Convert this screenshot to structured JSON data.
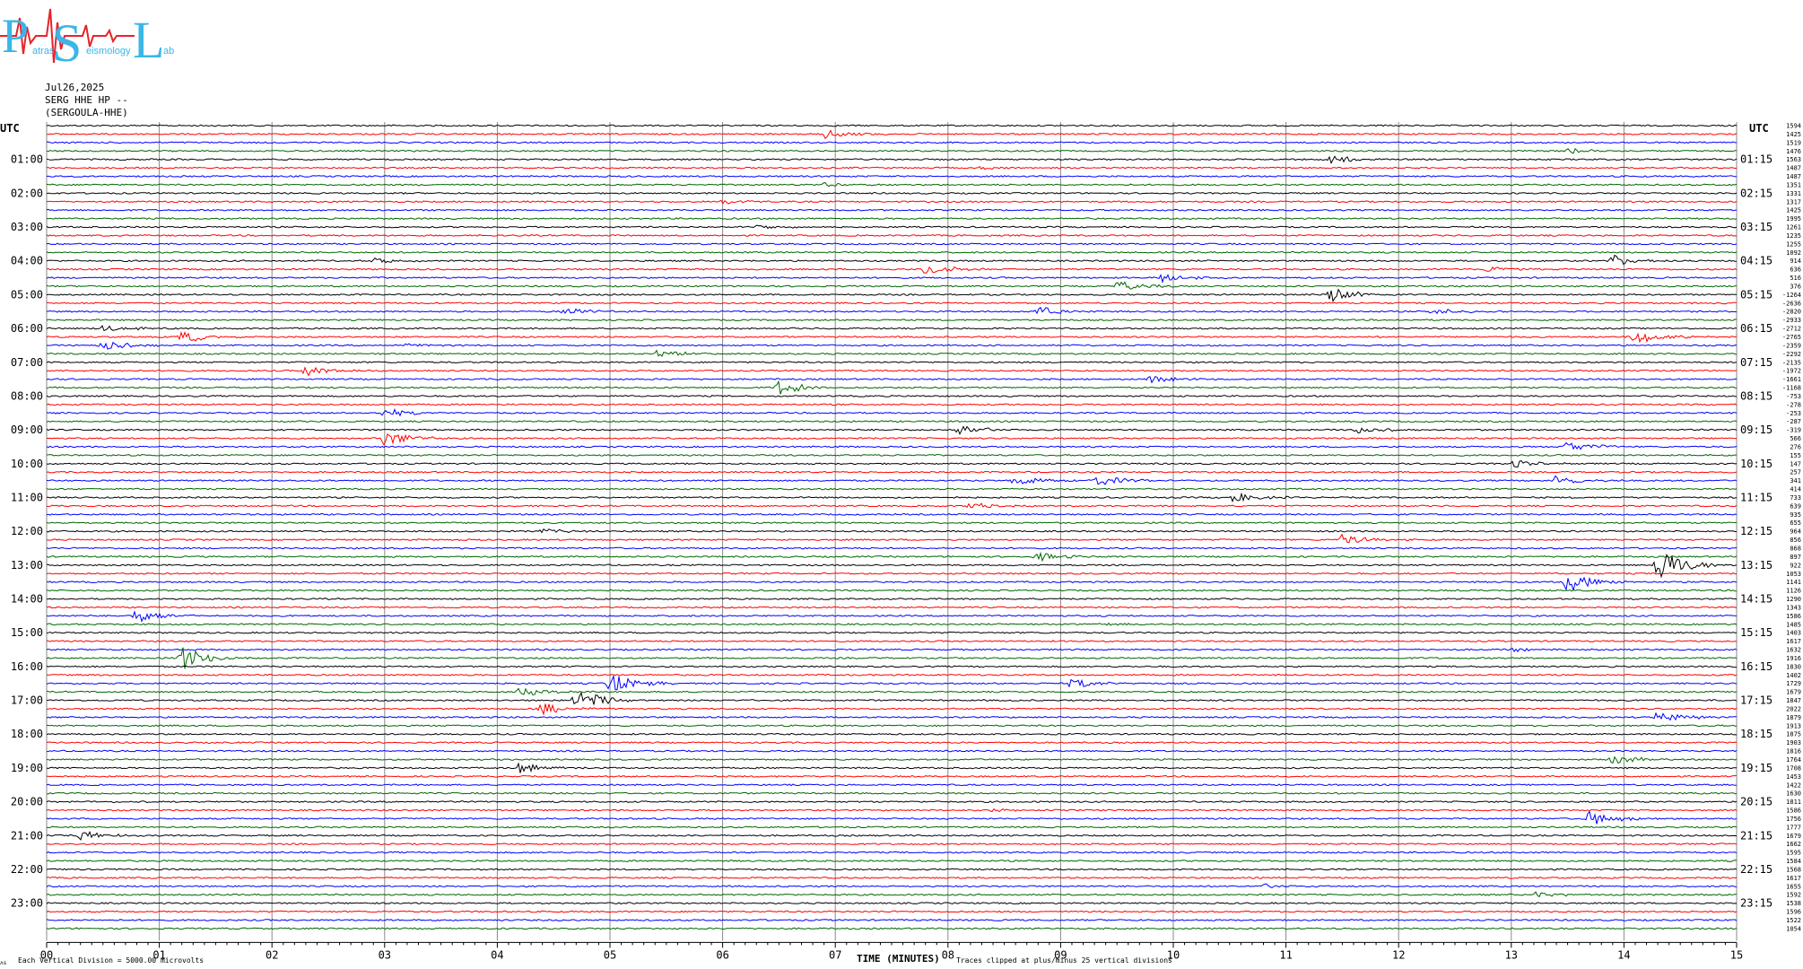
{
  "logo": {
    "letters": "PSL",
    "text_a": "atras",
    "text_b": "eismology",
    "text_c": "ab",
    "colors": {
      "letters": "#3ab6e8",
      "wave": "#e8222a"
    }
  },
  "header": {
    "date": "Jul26,2025",
    "station": "SERG HHE HP --",
    "name": "(SERGOULA-HHE)"
  },
  "axes": {
    "left_label": "UTC",
    "right_label": "UTC",
    "x_title": "TIME (MINUTES)",
    "footer_left": "Each Vertical Division = 5000.00 microvolts",
    "footer_right": "Traces clipped at plus/minus 25 vertical divisions",
    "corner_mark": "ʌs"
  },
  "chart_data": {
    "type": "line",
    "title": "",
    "xlabel": "TIME (MINUTES)",
    "xlim": [
      0,
      15
    ],
    "x_ticks": [
      "00",
      "01",
      "02",
      "03",
      "04",
      "05",
      "06",
      "07",
      "08",
      "09",
      "10",
      "11",
      "12",
      "13",
      "14",
      "15"
    ],
    "left_ticks": [
      "01:00",
      "02:00",
      "03:00",
      "04:00",
      "05:00",
      "06:00",
      "07:00",
      "08:00",
      "09:00",
      "10:00",
      "11:00",
      "12:00",
      "13:00",
      "14:00",
      "15:00",
      "16:00",
      "17:00",
      "18:00",
      "19:00",
      "20:00",
      "21:00",
      "22:00",
      "23:00"
    ],
    "right_ticks": [
      "01:15",
      "02:15",
      "03:15",
      "04:15",
      "05:15",
      "06:15",
      "07:15",
      "08:15",
      "09:15",
      "10:15",
      "11:15",
      "12:15",
      "13:15",
      "14:15",
      "15:15",
      "16:15",
      "17:15",
      "18:15",
      "19:15",
      "20:15",
      "21:15",
      "22:15",
      "23:15"
    ],
    "trace_colors": [
      "#000000",
      "#ff0000",
      "#0000ff",
      "#006600"
    ],
    "trace_count": 96,
    "trace_values": [
      "1594",
      "1425",
      "1519",
      "1476",
      "1563",
      "1487",
      "1487",
      "1351",
      "1331",
      "1317",
      "1425",
      "1995",
      "1261",
      "1235",
      "1255",
      "1092",
      "914",
      "636",
      "516",
      "376",
      "-1264",
      "-2636",
      "-2820",
      "-2933",
      "-2712",
      "-2765",
      "-2359",
      "-2292",
      "-2135",
      "-1972",
      "-1661",
      "-1168",
      "-753",
      "-278",
      "-253",
      "-287",
      "-319",
      "566",
      "276",
      "155",
      "147",
      "257",
      "341",
      "414",
      "733",
      "639",
      "935",
      "655",
      "964",
      "856",
      "868",
      "897",
      "922",
      "1053",
      "1141",
      "1126",
      "1290",
      "1343",
      "1586",
      "1485",
      "1403",
      "1617",
      "1632",
      "1916",
      "1830",
      "1402",
      "1729",
      "1679",
      "1847",
      "2022",
      "1879",
      "1913",
      "1875",
      "1903",
      "1816",
      "1764",
      "1708",
      "1453",
      "1422",
      "1630",
      "1811",
      "1586",
      "1756",
      "1777",
      "1679",
      "1662",
      "1595",
      "1584",
      "1568",
      "1617",
      "1655",
      "1592",
      "1538",
      "1596",
      "1522",
      "1054"
    ],
    "events": [
      {
        "row": 1,
        "minute": 6.9,
        "amp": 6
      },
      {
        "row": 3,
        "minute": 13.5,
        "amp": 3
      },
      {
        "row": 4,
        "minute": 11.4,
        "amp": 5
      },
      {
        "row": 5,
        "minute": 8.3,
        "amp": 2
      },
      {
        "row": 7,
        "minute": 6.9,
        "amp": 2
      },
      {
        "row": 9,
        "minute": 6.0,
        "amp": 3
      },
      {
        "row": 12,
        "minute": 6.3,
        "amp": 3
      },
      {
        "row": 16,
        "minute": 2.9,
        "amp": 3
      },
      {
        "row": 16,
        "minute": 13.9,
        "amp": 6
      },
      {
        "row": 17,
        "minute": 7.8,
        "amp": 8
      },
      {
        "row": 17,
        "minute": 12.8,
        "amp": 4
      },
      {
        "row": 18,
        "minute": 9.9,
        "amp": 6
      },
      {
        "row": 19,
        "minute": 9.5,
        "amp": 6
      },
      {
        "row": 20,
        "minute": 11.4,
        "amp": 9
      },
      {
        "row": 22,
        "minute": 4.6,
        "amp": 5
      },
      {
        "row": 22,
        "minute": 8.8,
        "amp": 6
      },
      {
        "row": 22,
        "minute": 12.3,
        "amp": 4
      },
      {
        "row": 24,
        "minute": 0.5,
        "amp": 4
      },
      {
        "row": 25,
        "minute": 1.2,
        "amp": 7
      },
      {
        "row": 25,
        "minute": 14.1,
        "amp": 8
      },
      {
        "row": 26,
        "minute": 0.5,
        "amp": 7
      },
      {
        "row": 26,
        "minute": 3.2,
        "amp": 2
      },
      {
        "row": 27,
        "minute": 5.4,
        "amp": 5
      },
      {
        "row": 29,
        "minute": 2.3,
        "amp": 6
      },
      {
        "row": 30,
        "minute": 9.8,
        "amp": 4
      },
      {
        "row": 31,
        "minute": 6.5,
        "amp": 8
      },
      {
        "row": 34,
        "minute": 3.0,
        "amp": 5
      },
      {
        "row": 36,
        "minute": 8.1,
        "amp": 7
      },
      {
        "row": 36,
        "minute": 11.6,
        "amp": 5
      },
      {
        "row": 37,
        "minute": 3.0,
        "amp": 10
      },
      {
        "row": 38,
        "minute": 13.5,
        "amp": 7
      },
      {
        "row": 40,
        "minute": 13.0,
        "amp": 5
      },
      {
        "row": 42,
        "minute": 8.6,
        "amp": 7
      },
      {
        "row": 42,
        "minute": 9.3,
        "amp": 7
      },
      {
        "row": 42,
        "minute": 13.4,
        "amp": 6
      },
      {
        "row": 44,
        "minute": 10.5,
        "amp": 6
      },
      {
        "row": 45,
        "minute": 8.2,
        "amp": 4
      },
      {
        "row": 48,
        "minute": 4.4,
        "amp": 3
      },
      {
        "row": 49,
        "minute": 11.5,
        "amp": 6
      },
      {
        "row": 51,
        "minute": 8.8,
        "amp": 5
      },
      {
        "row": 52,
        "minute": 14.3,
        "amp": 22
      },
      {
        "row": 54,
        "minute": 13.5,
        "amp": 12
      },
      {
        "row": 58,
        "minute": 0.8,
        "amp": 9
      },
      {
        "row": 59,
        "minute": 9.3,
        "amp": 2
      },
      {
        "row": 62,
        "minute": 13.0,
        "amp": 2
      },
      {
        "row": 63,
        "minute": 1.2,
        "amp": 14
      },
      {
        "row": 66,
        "minute": 5.0,
        "amp": 12
      },
      {
        "row": 66,
        "minute": 9.1,
        "amp": 6
      },
      {
        "row": 67,
        "minute": 4.2,
        "amp": 5
      },
      {
        "row": 68,
        "minute": 4.7,
        "amp": 14
      },
      {
        "row": 69,
        "minute": 4.4,
        "amp": 7
      },
      {
        "row": 70,
        "minute": 14.3,
        "amp": 7
      },
      {
        "row": 75,
        "minute": 13.9,
        "amp": 6
      },
      {
        "row": 76,
        "minute": 4.2,
        "amp": 6
      },
      {
        "row": 80,
        "minute": 0.5,
        "amp": 2
      },
      {
        "row": 81,
        "minute": 8.4,
        "amp": 2
      },
      {
        "row": 82,
        "minute": 13.7,
        "amp": 9
      },
      {
        "row": 84,
        "minute": 0.3,
        "amp": 6
      },
      {
        "row": 90,
        "minute": 10.8,
        "amp": 3
      },
      {
        "row": 91,
        "minute": 13.2,
        "amp": 4
      }
    ]
  }
}
